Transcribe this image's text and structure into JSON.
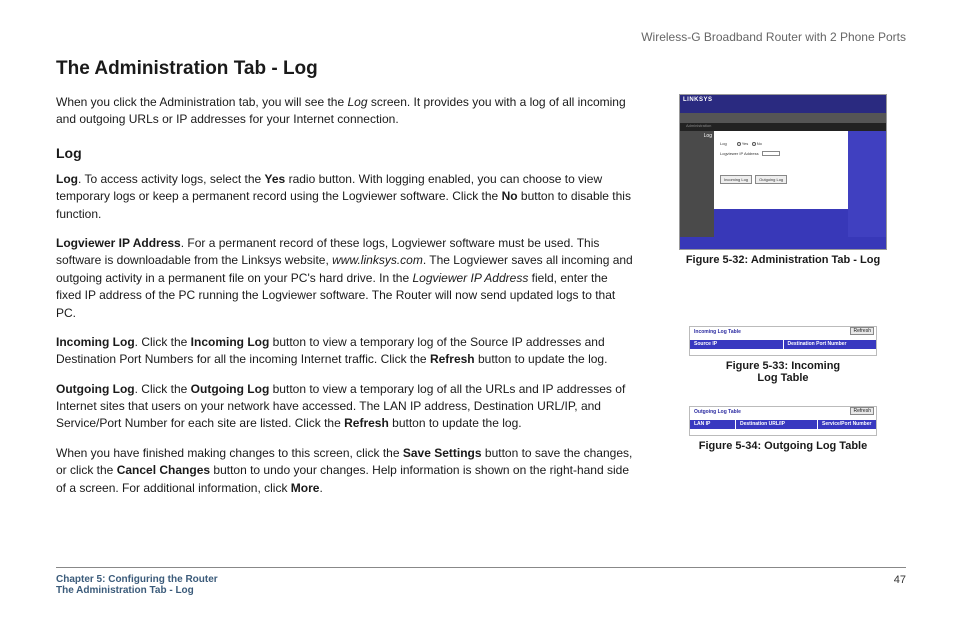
{
  "product_header": "Wireless-G Broadband Router with 2 Phone Ports",
  "title": "The Administration Tab - Log",
  "intro_pre": "When you click the Administration tab, you will see the ",
  "intro_ital": "Log",
  "intro_post": " screen. It provides you with a log of all incoming and outgoing URLs or IP addresses for your Internet connection.",
  "section_h": "Log",
  "p1": {
    "b1": "Log",
    "t1": ". To access activity logs, select the ",
    "b2": "Yes",
    "t2": " radio button. With logging enabled, you can choose to view temporary logs or keep a permanent record using the Logviewer software. Click the ",
    "b3": "No",
    "t3": " button to disable this function."
  },
  "p2": {
    "b1": "Logviewer IP Address",
    "t1": ". For a permanent record of these logs, Logviewer software must be used. This software is downloadable from the Linksys website, ",
    "i1": "www.linksys.com",
    "t2": ". The Logviewer saves all incoming and outgoing activity in a permanent file on your PC's hard drive. In the ",
    "i2": "Logviewer IP Address",
    "t3": " field, enter the fixed IP address of the PC running the Logviewer software. The Router will now send updated logs to that PC."
  },
  "p3": {
    "b1": "Incoming Log",
    "t1": ". Click the ",
    "b2": "Incoming Log",
    "t2": " button to view a temporary log of the Source IP addresses and Destination Port Numbers for all the incoming Internet traffic. Click the ",
    "b3": "Refresh",
    "t3": " button to update the log."
  },
  "p4": {
    "b1": "Outgoing Log",
    "t1": ". Click the ",
    "b2": "Outgoing Log",
    "t2": " button to view a temporary log of all the URLs and IP addresses of Internet sites that users on your network have accessed. The LAN IP address, Destination URL/IP, and Service/Port Number for each site are listed. Click the ",
    "b3": "Refresh",
    "t3": " button to update the log."
  },
  "p5": {
    "t1": "When you have finished making changes to this screen, click the ",
    "b1": "Save Settings",
    "t2": " button to save the changes, or click the ",
    "b2": "Cancel Changes",
    "t3": " button to undo your changes. Help information is shown on the right-hand side of a screen. For additional information, click ",
    "b3": "More",
    "t4": "."
  },
  "fig32": {
    "brand": "LINKSYS",
    "nav_label": "Administration",
    "log_label": "Log",
    "yes": "Yes",
    "no": "No",
    "ip_label": "Logviewer IP Address",
    "btn_in": "Incoming Log",
    "btn_out": "Outgoing Log",
    "caption": "Figure 5-32: Administration Tab - Log"
  },
  "fig33": {
    "title": "Incoming Log Table",
    "refresh": "Refresh",
    "col1": "Source IP",
    "col2": "Destination Port Number",
    "caption": "Figure 5-33: Incoming Log Table"
  },
  "fig34": {
    "title": "Outgoing Log Table",
    "refresh": "Refresh",
    "col1": "LAN IP",
    "col2": "Destination URL/IP",
    "col3": "Service/Port Number",
    "caption": "Figure 5-34: Outgoing Log Table"
  },
  "footer": {
    "chapter": "Chapter 5: Configuring the Router",
    "section": "The Administration Tab - Log",
    "page": "47"
  }
}
